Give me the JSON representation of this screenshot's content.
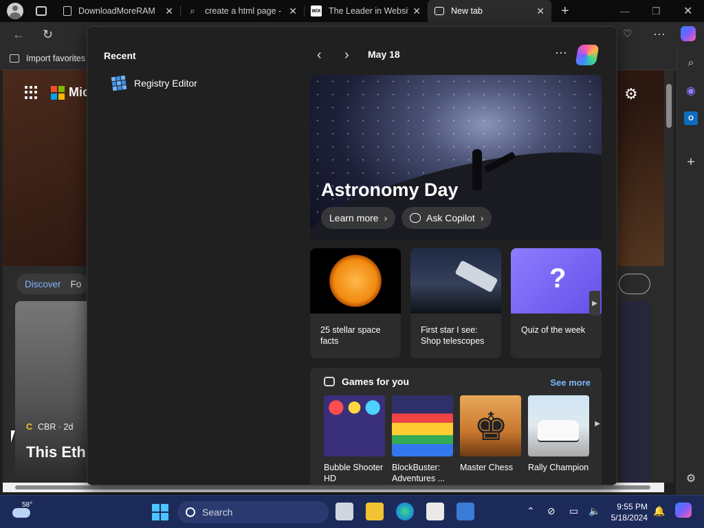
{
  "browser": {
    "tabs": [
      {
        "title": "DownloadMoreRAM",
        "favicon": "page-icon",
        "active": false
      },
      {
        "title": "create a html page -",
        "favicon": "search-icon",
        "active": false
      },
      {
        "title": "The Leader in Websit",
        "favicon": "wix-icon",
        "favicon_text": "WiX",
        "active": false
      },
      {
        "title": "New tab",
        "favicon": "newtab-icon",
        "active": true
      }
    ],
    "favorites_bar": {
      "import_label": "Import favorites"
    }
  },
  "flyout": {
    "recent_title": "Recent",
    "recent_items": [
      {
        "label": "Registry Editor",
        "icon": "registry-editor-icon"
      }
    ],
    "date": "May 18",
    "hero": {
      "title": "Astronomy Day",
      "learn_more": "Learn more",
      "ask_copilot": "Ask Copilot"
    },
    "cards": [
      {
        "title": "25 stellar space facts"
      },
      {
        "title": "First star I see: Shop telescopes"
      },
      {
        "title": "Quiz of the week"
      }
    ],
    "games": {
      "title": "Games for you",
      "see_more": "See more",
      "items": [
        {
          "name": "Bubble Shooter HD"
        },
        {
          "name": "BlockBuster: Adventures ..."
        },
        {
          "name": "Master Chess"
        },
        {
          "name": "Rally Champion"
        }
      ]
    }
  },
  "background_page": {
    "brand": "Mic",
    "discover_tab": "Discover",
    "next_tab": "Fo",
    "card": {
      "source": "CBR · 2d",
      "headline": "This Eth Western"
    }
  },
  "taskbar": {
    "weather_temp": "58°",
    "search_placeholder": "Search",
    "time": "9:55 PM",
    "date": "5/18/2024"
  }
}
